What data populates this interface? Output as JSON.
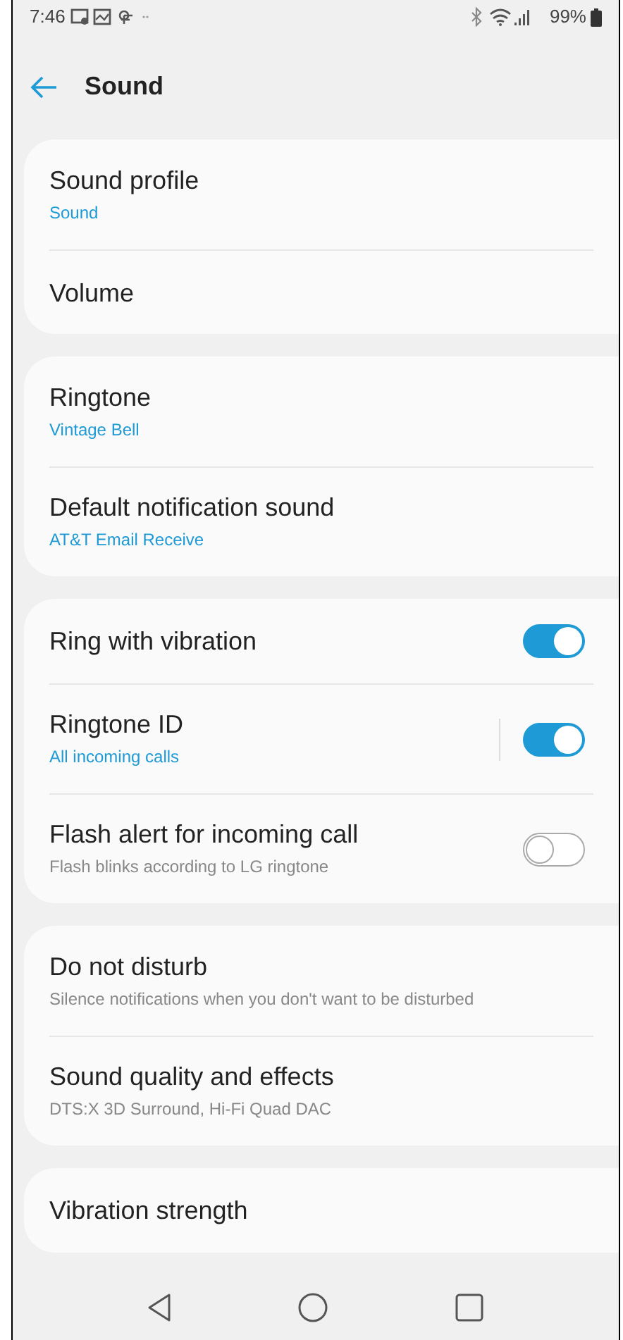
{
  "status_bar": {
    "time": "7:46",
    "battery": "99%"
  },
  "header": {
    "title": "Sound"
  },
  "sections": [
    {
      "items": [
        {
          "kind": "link",
          "title": "Sound profile",
          "subtitle": {
            "kind": "value",
            "text": "Sound"
          }
        },
        {
          "kind": "link",
          "title": "Volume"
        }
      ]
    },
    {
      "items": [
        {
          "kind": "link",
          "title": "Ringtone",
          "subtitle": {
            "kind": "value",
            "text": "Vintage Bell"
          }
        },
        {
          "kind": "link",
          "title": "Default notification sound",
          "subtitle": {
            "kind": "value",
            "text": "AT&T Email Receive"
          }
        }
      ]
    },
    {
      "items": [
        {
          "kind": "toggle",
          "title": "Ring with vibration",
          "on": true
        },
        {
          "kind": "split_toggle",
          "title": "Ringtone ID",
          "subtitle": {
            "kind": "value",
            "text": "All incoming calls"
          },
          "on": true
        },
        {
          "kind": "toggle",
          "title": "Flash alert for incoming call",
          "subtitle": {
            "kind": "hint",
            "text": "Flash blinks according to LG ringtone"
          },
          "on": false
        }
      ]
    },
    {
      "items": [
        {
          "kind": "link",
          "title": "Do not disturb",
          "subtitle": {
            "kind": "hint",
            "text": "Silence notifications when you don't want to be disturbed"
          }
        },
        {
          "kind": "link",
          "title": "Sound quality and effects",
          "subtitle": {
            "kind": "hint",
            "text": "DTS:X 3D Surround, Hi-Fi Quad DAC"
          }
        }
      ]
    },
    {
      "items": [
        {
          "kind": "link",
          "title": "Vibration strength"
        }
      ]
    }
  ]
}
